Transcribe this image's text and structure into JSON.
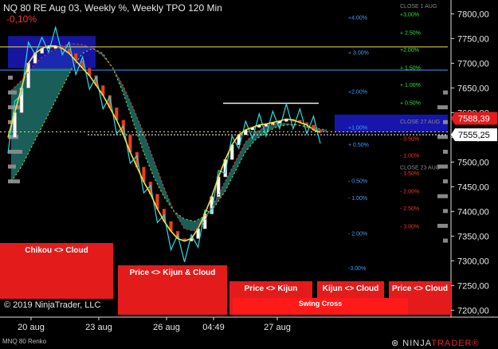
{
  "header": {
    "title": "NQ 80 RE Aug 03, Weekly %, Weekly TPO 120 Min",
    "change": "-0,10%",
    "copyright": "© 2019 NinjaTrader, LLC",
    "instrument": "MNQ 80 Renko",
    "logo_prefix": "NINJA",
    "logo_suffix": "TRADER®"
  },
  "colors": {
    "background": "#000000",
    "bull_candle": "#ffffff",
    "bear_candle": "#e8401c",
    "cyan_line": "#22e0e8",
    "yellow_line": "#f0e040",
    "red_dotted": "#e83030",
    "green_dotted": "#7fd030",
    "cloud": "#1e6e6a",
    "tpo_profile": "#1a1ac8",
    "signal_box": "#e41b1b"
  },
  "signals": [
    {
      "label": "Chikou <> Cloud"
    },
    {
      "label": "Price <> Kijun & Cloud"
    },
    {
      "label": "Price <> Kijun"
    },
    {
      "label": "Kijun <> Cloud"
    },
    {
      "label": "Price <> Cloud"
    },
    {
      "label": "Swing Cross"
    }
  ],
  "chart_data": {
    "type": "line",
    "title": "NQ 80 RE Aug 03, Weekly %, Weekly TPO 120 Min",
    "x_ticks": [
      "20 aug",
      "23 aug",
      "26 aug",
      "04:49",
      "27 aug"
    ],
    "y_ticks": [
      7800,
      7750,
      7700,
      7650,
      7600,
      7550,
      7500,
      7450,
      7400,
      7350,
      7300,
      7250,
      7200
    ],
    "y_tick_labels": [
      "7800,00",
      "7750,00",
      "7700,00",
      "7650,00",
      "7600,00",
      "7550,00",
      "7500,00",
      "7450,00",
      "7400,00",
      "7350,00",
      "7300,00",
      "7250,00",
      "7200,00"
    ],
    "ylim": [
      7186,
      7828
    ],
    "price_labels": [
      {
        "text": "7588,39",
        "value": 7588.39,
        "color": "#e41b1b"
      },
      {
        "text": "7555,25",
        "value": 7555.25,
        "color": "#ffffff"
      }
    ],
    "weekly_levels": [
      {
        "label": "+4.00%",
        "value": 7793,
        "color": "#3aa0ff"
      },
      {
        "label": "+ 3.00%",
        "value": 7722,
        "color": "#3aa0ff"
      },
      {
        "label": "+2.00%",
        "value": 7643,
        "color": "#3aa0ff"
      },
      {
        "label": "+1.00%",
        "value": 7571,
        "color": "#3aa0ff"
      },
      {
        "label": "+ 0.50%",
        "value": 7536,
        "color": "#3aa0ff"
      },
      {
        "label": "- 0.50%",
        "value": 7463,
        "color": "#3aa0ff"
      },
      {
        "label": "- 1.00%",
        "value": 7428,
        "color": "#3aa0ff"
      },
      {
        "label": "- 2.00%",
        "value": 7356,
        "color": "#3aa0ff"
      },
      {
        "label": "-3.00%",
        "value": 7286,
        "color": "#3aa0ff"
      }
    ],
    "daily_levels": [
      {
        "label": "CLOSE 1 AUG",
        "value": 7817,
        "color": "#888888"
      },
      {
        "label": "+3,00%",
        "value": 7800,
        "color": "#35e035"
      },
      {
        "label": "+ 2.50%",
        "value": 7763,
        "color": "#35e035"
      },
      {
        "label": "+2.00%",
        "value": 7728,
        "color": "#35e035"
      },
      {
        "label": "+ 1.50%",
        "value": 7692,
        "color": "#35e035"
      },
      {
        "label": "+ 1.00%",
        "value": 7657,
        "color": "#35e035"
      },
      {
        "label": "+ 0.50%",
        "value": 7621,
        "color": "#35e035"
      },
      {
        "label": "CLOSE 27 AUG",
        "value": 7583,
        "color": "#888888"
      },
      {
        "label": "- 0.50%",
        "value": 7548,
        "color": "#ff3030"
      },
      {
        "label": "- 1.00%",
        "value": 7514,
        "color": "#ff3030"
      },
      {
        "label": "CLOSE 23 AUG",
        "value": 7490,
        "color": "#888888"
      },
      {
        "label": "- 1.50%",
        "value": 7478,
        "color": "#ff3030"
      },
      {
        "label": "- 2.00%",
        "value": 7442,
        "color": "#ff3030"
      },
      {
        "label": "- 2.50%",
        "value": 7407,
        "color": "#ff3030"
      },
      {
        "label": "- 3.00%",
        "value": 7371,
        "color": "#ff3030"
      }
    ],
    "horizontal_lines": [
      {
        "value": 7733,
        "color": "#f0e040"
      },
      {
        "value": 7686,
        "color": "#3aa0ff"
      },
      {
        "value": 7619,
        "color": "#ffffff"
      },
      {
        "value": 7561,
        "color": "#f0e040"
      }
    ],
    "series": [
      {
        "values": [
          7540,
          7600,
          7660,
          7720,
          7740,
          7730,
          7745,
          7750,
          7740,
          7720,
          7700,
          7690,
          7670,
          7650,
          7630,
          7610,
          7580,
          7550,
          7520,
          7490,
          7460,
          7430,
          7400,
          7370,
          7345,
          7330,
          7320,
          7330,
          7350,
          7380,
          7420,
          7460,
          7500,
          7530,
          7550,
          7560,
          7570,
          7575,
          7575,
          7580,
          7590,
          7595,
          7590,
          7585,
          7580,
          7570,
          7560
        ],
        "color": "#22e0e8"
      },
      {
        "values": [
          7550,
          7600,
          7650,
          7700,
          7720,
          7730,
          7735,
          7735,
          7730,
          7720,
          7705,
          7690,
          7675,
          7655,
          7635,
          7610,
          7585,
          7555,
          7520,
          7490,
          7460,
          7435,
          7405,
          7380,
          7360,
          7345,
          7340,
          7345,
          7365,
          7395,
          7430,
          7470,
          7505,
          7535,
          7555,
          7565,
          7570,
          7575,
          7577,
          7580,
          7583,
          7587,
          7585,
          7580,
          7575,
          7565,
          7560
        ],
        "color": "#f0e040"
      },
      {
        "values": [
          7645,
          7665,
          7690,
          7712,
          7725,
          7735,
          7740,
          7738,
          7730,
          7715,
          7690,
          7655,
          7610,
          7560,
          7505,
          7450,
          7400,
          7365,
          7360,
          7380,
          7420,
          7460,
          7500,
          7540,
          7560,
          7572,
          7578,
          7578,
          7576,
          7570,
          7565,
          7560
        ],
        "color": "#e83030"
      },
      {
        "values": [
          7460,
          7490,
          7530,
          7570,
          7610,
          7650,
          7690,
          7720,
          7730,
          7720,
          7690,
          7640,
          7580,
          7520,
          7470,
          7430,
          7400,
          7385,
          7380,
          7390,
          7410,
          7440,
          7480,
          7520,
          7545,
          7560,
          7570,
          7575,
          7575,
          7572,
          7568,
          7565
        ],
        "color": "#7fd030"
      }
    ]
  }
}
